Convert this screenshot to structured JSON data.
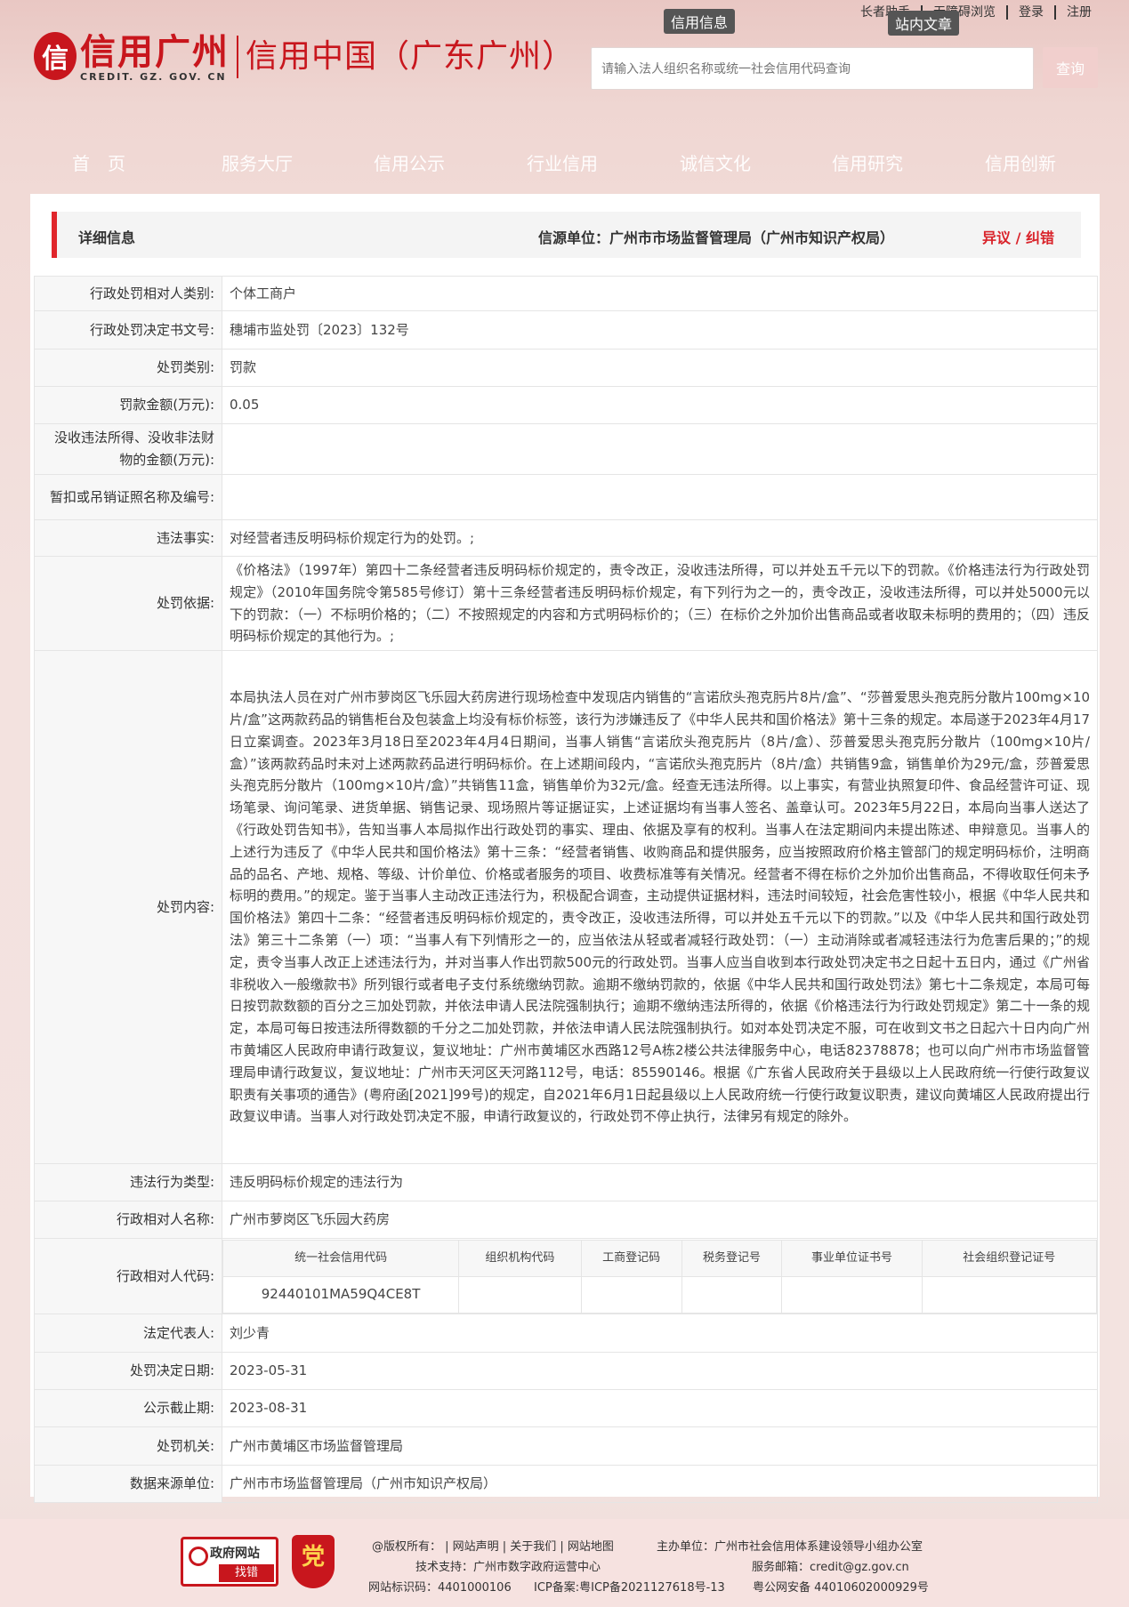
{
  "header": {
    "top_links": [
      "长者助手",
      "无障碍浏览",
      "登录",
      "注册"
    ],
    "tooltip_left": "信用信息",
    "tooltip_right": "站内文章",
    "logo_mark": "信",
    "logo_name": "信用广州",
    "logo_domain": "CREDIT. GZ. GOV. CN",
    "site_name": "信用中国（广东广州）",
    "search_placeholder": "请输入法人组织名称或统一社会信用代码查询",
    "search_button": "查询"
  },
  "nav": [
    "首　页",
    "服务大厅",
    "信用公示",
    "行业信用",
    "诚信文化",
    "信用研究",
    "信用创新"
  ],
  "detail": {
    "title": "详细信息",
    "source": "信源单位：广州市市场监督管理局（广州市知识产权局）",
    "objection": "异议 / 纠错",
    "rows": [
      {
        "key": "行政处罚相对人类别:",
        "value": "个体工商户"
      },
      {
        "key": "行政处罚决定书文号:",
        "value": "穗埔市监处罚〔2023〕132号"
      },
      {
        "key": "处罚类别:",
        "value": "罚款"
      },
      {
        "key": "罚款金额(万元):",
        "value": "0.05"
      },
      {
        "key": "没收违法所得、没收非法财物的金额(万元):",
        "value": ""
      },
      {
        "key": "暂扣或吊销证照名称及编号:",
        "value": ""
      },
      {
        "key": "违法事实:",
        "value": "对经营者违反明码标价规定行为的处罚。;"
      },
      {
        "key": "处罚依据:",
        "value": "《价格法》（1997年）第四十二条经营者违反明码标价规定的，责令改正，没收违法所得，可以并处五千元以下的罚款。《价格违法行为行政处罚规定》（2010年国务院令第585号修订）第十三条经营者违反明码标价规定，有下列行为之一的，责令改正，没收违法所得，可以并处5000元以下的罚款：（一）不标明价格的；（二）不按照规定的内容和方式明码标价的；（三）在标价之外加价出售商品或者收取未标明的费用的；（四）违反明码标价规定的其他行为。;"
      },
      {
        "key": "处罚内容:",
        "value": "本局执法人员在对广州市萝岗区飞乐园大药房进行现场检查中发现店内销售的“言诺欣头孢克肟片8片/盒”、“莎普爱思头孢克肟分散片100mg×10片/盒”这两款药品的销售柜台及包装盒上均没有标价标签，该行为涉嫌违反了《中华人民共和国价格法》第十三条的规定。本局遂于2023年4月17日立案调查。2023年3月18日至2023年4月4日期间，当事人销售“言诺欣头孢克肟片（8片/盒）、莎普爱思头孢克肟分散片（100mg×10片/盒）”该两款药品时未对上述两款药品进行明码标价。在上述期间段内，“言诺欣头孢克肟片（8片/盒）共销售9盒，销售单价为29元/盒，莎普爱思头孢克肟分散片（100mg×10片/盒）”共销售11盒，销售单价为32元/盒。经查无违法所得。以上事实，有营业执照复印件、食品经营许可证、现场笔录、询问笔录、进货单据、销售记录、现场照片等证据证实，上述证据均有当事人签名、盖章认可。2023年5月22日，本局向当事人送达了《行政处罚告知书》，告知当事人本局拟作出行政处罚的事实、理由、依据及享有的权利。当事人在法定期间内未提出陈述、申辩意见。当事人的上述行为违反了《中华人民共和国价格法》第十三条：“经营者销售、收购商品和提供服务，应当按照政府价格主管部门的规定明码标价，注明商品的品名、产地、规格、等级、计价单位、价格或者服务的项目、收费标准等有关情况。经营者不得在标价之外加价出售商品，不得收取任何未予标明的费用。”的规定。鉴于当事人主动改正违法行为，积极配合调查，主动提供证据材料，违法时间较短，社会危害性较小，根据《中华人民共和国价格法》第四十二条：“经营者违反明码标价规定的，责令改正，没收违法所得，可以并处五千元以下的罚款。”以及《中华人民共和国行政处罚法》第三十二条第（一）项：“当事人有下列情形之一的，应当依法从轻或者减轻行政处罚：（一）主动消除或者减轻违法行为危害后果的；”的规定，责令当事人改正上述违法行为，并对当事人作出罚款500元的行政处罚。当事人应当自收到本行政处罚决定书之日起十五日内，通过《广州省非税收入一般缴款书》所列银行或者电子支付系统缴纳罚款。逾期不缴纳罚款的，依据《中华人民共和国行政处罚法》第七十二条规定，本局可每日按罚款数额的百分之三加处罚款，并依法申请人民法院强制执行；逾期不缴纳违法所得的，依据《价格违法行为行政处罚规定》第二十一条的规定，本局可每日按违法所得数额的千分之二加处罚款，并依法申请人民法院强制执行。如对本处罚决定不服，可在收到文书之日起六十日内向广州市黄埔区人民政府申请行政复议，复议地址：广州市黄埔区水西路12号A栋2楼公共法律服务中心，电话82378878；也可以向广州市市场监督管理局申请行政复议，复议地址：广州市天河区天河路112号，电话：85590146。根据《广东省人民政府关于县级以上人民政府统一行使行政复议职责有关事项的通告》(粤府函[2021]99号)的规定，自2021年6月1日起县级以上人民政府统一行使行政复议职责，建议向黄埔区人民政府提出行政复议申请。当事人对行政处罚决定不服，申请行政复议的，行政处罚不停止执行，法律另有规定的除外。"
      },
      {
        "key": "违法行为类型:",
        "value": "违反明码标价规定的违法行为"
      },
      {
        "key": "行政相对人名称:",
        "value": "广州市萝岗区飞乐园大药房"
      }
    ],
    "code_row_key": "行政相对人代码:",
    "code_headers": [
      "统一社会信用代码",
      "组织机构代码",
      "工商登记码",
      "税务登记号",
      "事业单位证书号",
      "社会组织登记证号"
    ],
    "code_values": [
      "92440101MA59Q4CE8T",
      "",
      "",
      "",
      "",
      ""
    ],
    "rows_after": [
      {
        "key": "法定代表人:",
        "value": "刘少青"
      },
      {
        "key": "处罚决定日期:",
        "value": "2023-05-31"
      },
      {
        "key": "公示截止期:",
        "value": "2023-08-31"
      },
      {
        "key": "处罚机关:",
        "value": "广州市黄埔区市场监督管理局"
      },
      {
        "key": "数据来源单位:",
        "value": "广州市市场监督管理局（广州市知识产权局）"
      }
    ]
  },
  "footer": {
    "badge_top": "政府网站",
    "badge_bottom": "找错",
    "emblem": "党",
    "line1_left": "@版权所有：  | 网站声明 | 关于我们 | 网站地图",
    "line1_right": "主办单位：广州市社会信用体系建设领导小组办公室",
    "line2_left": "技术支持：广州市数字政府运营中心",
    "line2_right": "服务邮箱：credit@gz.gov.cn",
    "line3_a": "网站标识码：4401000106",
    "line3_b": "ICP备案:粤ICP备2021127618号-13",
    "line3_c": "粤公网安备 44010602000929号"
  }
}
